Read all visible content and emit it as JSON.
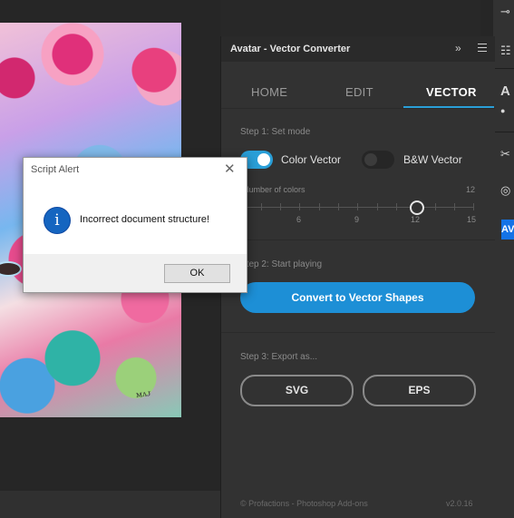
{
  "panel": {
    "title": "Avatar - Vector Converter",
    "collapse_icon": "double-chevron-right-icon",
    "menu_icon": "hamburger-menu-icon",
    "tabs": [
      {
        "label": "HOME",
        "active": false
      },
      {
        "label": "EDIT",
        "active": false
      },
      {
        "label": "VECTOR",
        "active": true
      }
    ],
    "step1": {
      "label": "Step 1: Set mode",
      "color_vector": {
        "label": "Color Vector",
        "on": true
      },
      "bw_vector": {
        "label": "B&W Vector",
        "on": false
      },
      "slider": {
        "label": "Number of colors",
        "value": 12,
        "value_text": "12",
        "min": 3,
        "max": 15,
        "tick_labels": [
          "6",
          "9",
          "12",
          "15"
        ]
      }
    },
    "step2": {
      "label": "Step 2: Start playing",
      "button": "Convert to Vector Shapes"
    },
    "step3": {
      "label": "Step 3: Export as...",
      "svg_button": "SVG",
      "eps_button": "EPS"
    },
    "footer": {
      "credit": "© Profactions - Photoshop Add-ons",
      "version": "v2.0.16"
    },
    "accent_color": "#2a9fd8"
  },
  "dialog": {
    "title": "Script Alert",
    "message": "Incorrect document structure!",
    "ok_label": "OK",
    "close_icon": "close-icon",
    "info_icon_glyph": "i"
  },
  "right_strip": {
    "active_label": "AV"
  }
}
